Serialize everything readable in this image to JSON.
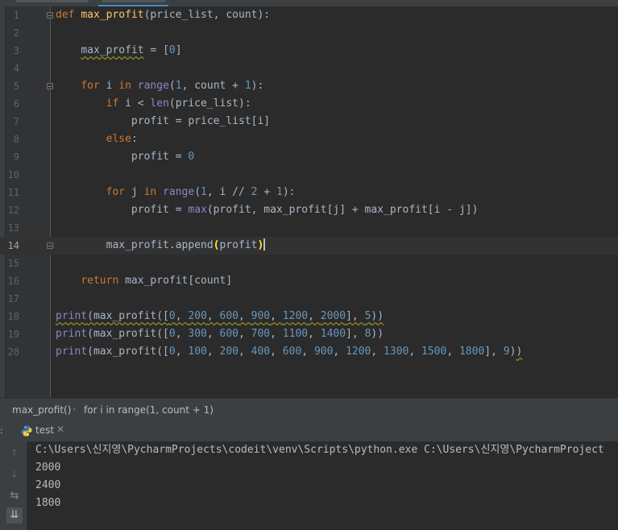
{
  "editor": {
    "current_line": 14,
    "lines": [
      {
        "num": "1",
        "tokens": [
          {
            "t": "def ",
            "c": "kw"
          },
          {
            "t": "max_profit",
            "c": "fn"
          },
          {
            "t": "(price_list, count):"
          }
        ]
      },
      {
        "num": "2",
        "tokens": []
      },
      {
        "num": "3",
        "tokens": [
          {
            "t": "    "
          },
          {
            "t": "max_profit",
            "c": "sq"
          },
          {
            "t": " = ["
          },
          {
            "t": "0",
            "c": "num"
          },
          {
            "t": "]"
          }
        ]
      },
      {
        "num": "4",
        "tokens": []
      },
      {
        "num": "5",
        "tokens": [
          {
            "t": "    "
          },
          {
            "t": "for ",
            "c": "kw"
          },
          {
            "t": "i "
          },
          {
            "t": "in ",
            "c": "kw"
          },
          {
            "t": "range",
            "c": "bi"
          },
          {
            "t": "("
          },
          {
            "t": "1",
            "c": "num"
          },
          {
            "t": ", count + "
          },
          {
            "t": "1",
            "c": "num"
          },
          {
            "t": "):"
          }
        ]
      },
      {
        "num": "6",
        "tokens": [
          {
            "t": "        "
          },
          {
            "t": "if ",
            "c": "kw"
          },
          {
            "t": "i < "
          },
          {
            "t": "len",
            "c": "bi"
          },
          {
            "t": "(price_list):"
          }
        ]
      },
      {
        "num": "7",
        "tokens": [
          {
            "t": "            profit = price_list[i]"
          }
        ]
      },
      {
        "num": "8",
        "tokens": [
          {
            "t": "        "
          },
          {
            "t": "else",
            "c": "kw"
          },
          {
            "t": ":"
          }
        ]
      },
      {
        "num": "9",
        "tokens": [
          {
            "t": "            profit = "
          },
          {
            "t": "0",
            "c": "num"
          }
        ]
      },
      {
        "num": "10",
        "tokens": []
      },
      {
        "num": "11",
        "tokens": [
          {
            "t": "        "
          },
          {
            "t": "for ",
            "c": "kw"
          },
          {
            "t": "j "
          },
          {
            "t": "in ",
            "c": "kw"
          },
          {
            "t": "range",
            "c": "bi"
          },
          {
            "t": "("
          },
          {
            "t": "1",
            "c": "num"
          },
          {
            "t": ", i // "
          },
          {
            "t": "2",
            "c": "num"
          },
          {
            "t": " + "
          },
          {
            "t": "1",
            "c": "num"
          },
          {
            "t": "):"
          }
        ]
      },
      {
        "num": "12",
        "tokens": [
          {
            "t": "            profit = "
          },
          {
            "t": "max",
            "c": "bi"
          },
          {
            "t": "(profit, max_profit[j] + max_profit[i - j])"
          }
        ]
      },
      {
        "num": "13",
        "tokens": []
      },
      {
        "num": "14",
        "tokens": [
          {
            "t": "        max_profit.append"
          },
          {
            "t": "(",
            "c": "brace-match"
          },
          {
            "t": "profit"
          },
          {
            "t": ")",
            "c": "brace-match"
          },
          {
            "t": "",
            "c": "caret"
          }
        ]
      },
      {
        "num": "15",
        "tokens": []
      },
      {
        "num": "16",
        "tokens": [
          {
            "t": "    "
          },
          {
            "t": "return ",
            "c": "kw"
          },
          {
            "t": "max_profit[count]"
          }
        ]
      },
      {
        "num": "17",
        "tokens": []
      },
      {
        "num": "18",
        "tokens": [
          {
            "t": "print",
            "c": "bi sq"
          },
          {
            "t": "(max_profit([",
            "c": "sq"
          },
          {
            "t": "0",
            "c": "num sq"
          },
          {
            "t": ", ",
            "c": "sq"
          },
          {
            "t": "200",
            "c": "num sq"
          },
          {
            "t": ", ",
            "c": "sq"
          },
          {
            "t": "600",
            "c": "num sq"
          },
          {
            "t": ", ",
            "c": "sq"
          },
          {
            "t": "900",
            "c": "num sq"
          },
          {
            "t": ", ",
            "c": "sq"
          },
          {
            "t": "1200",
            "c": "num sq"
          },
          {
            "t": ", ",
            "c": "sq"
          },
          {
            "t": "2000",
            "c": "num sq"
          },
          {
            "t": "], ",
            "c": "sq"
          },
          {
            "t": "5",
            "c": "num sq"
          },
          {
            "t": "))",
            "c": "sq"
          }
        ]
      },
      {
        "num": "19",
        "tokens": [
          {
            "t": "print",
            "c": "bi"
          },
          {
            "t": "(max_profit(["
          },
          {
            "t": "0",
            "c": "num"
          },
          {
            "t": ", "
          },
          {
            "t": "300",
            "c": "num"
          },
          {
            "t": ", "
          },
          {
            "t": "600",
            "c": "num"
          },
          {
            "t": ", "
          },
          {
            "t": "700",
            "c": "num"
          },
          {
            "t": ", "
          },
          {
            "t": "1100",
            "c": "num"
          },
          {
            "t": ", "
          },
          {
            "t": "1400",
            "c": "num"
          },
          {
            "t": "], "
          },
          {
            "t": "8",
            "c": "num"
          },
          {
            "t": "))"
          }
        ]
      },
      {
        "num": "20",
        "tokens": [
          {
            "t": "print",
            "c": "bi"
          },
          {
            "t": "(max_profit(["
          },
          {
            "t": "0",
            "c": "num"
          },
          {
            "t": ", "
          },
          {
            "t": "100",
            "c": "num"
          },
          {
            "t": ", "
          },
          {
            "t": "200",
            "c": "num"
          },
          {
            "t": ", "
          },
          {
            "t": "400",
            "c": "num"
          },
          {
            "t": ", "
          },
          {
            "t": "600",
            "c": "num"
          },
          {
            "t": ", "
          },
          {
            "t": "900",
            "c": "num"
          },
          {
            "t": ", "
          },
          {
            "t": "1200",
            "c": "num"
          },
          {
            "t": ", "
          },
          {
            "t": "1300",
            "c": "num"
          },
          {
            "t": ", "
          },
          {
            "t": "1500",
            "c": "num"
          },
          {
            "t": ", "
          },
          {
            "t": "1800",
            "c": "num"
          },
          {
            "t": "], "
          },
          {
            "t": "9",
            "c": "num"
          },
          {
            "t": ")"
          },
          {
            "t": ")",
            "c": "sq"
          }
        ]
      }
    ],
    "fold_marker_lines": [
      1,
      5,
      14
    ]
  },
  "breadcrumb": {
    "function": "max_profit()",
    "separator": "›",
    "loop": "for i in range(1, count + 1)"
  },
  "run_panel": {
    "edge_label": ":",
    "tab_label": "test",
    "tab_close": "✕",
    "tab_icon": "python-icon",
    "tools": [
      {
        "icon": "arrow-up-icon",
        "glyph": "↑",
        "state": "dim"
      },
      {
        "icon": "arrow-down-icon",
        "glyph": "↓",
        "state": "dim"
      },
      {
        "icon": "soft-wrap-icon",
        "glyph": "⇆",
        "state": "normal"
      },
      {
        "icon": "scroll-to-end-icon",
        "glyph": "⇊",
        "state": "active"
      }
    ],
    "console_lines": [
      "C:\\Users\\신지영\\PycharmProjects\\codeit\\venv\\Scripts\\python.exe C:\\Users\\신지영\\PycharmProject",
      "2000",
      "2400",
      "1800"
    ]
  },
  "colors": {
    "background": "#2b2b2b",
    "keyword": "#cc7832",
    "function": "#ffc66d",
    "number": "#6897bb",
    "builtin": "#8888c6",
    "text": "#a9b7c6"
  }
}
